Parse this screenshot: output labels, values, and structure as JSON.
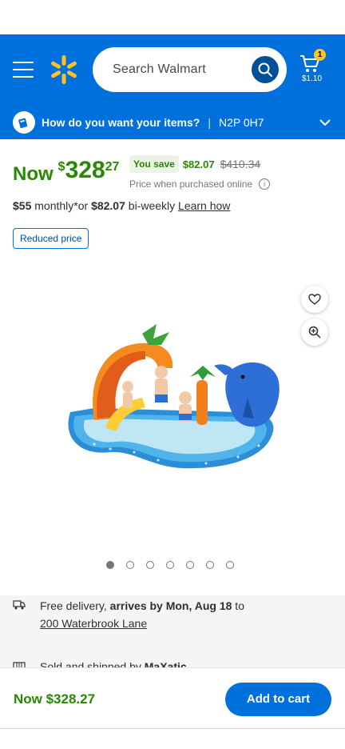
{
  "header": {
    "search_placeholder": "Search Walmart",
    "cart_count": "1",
    "cart_total": "$1.10"
  },
  "delivery_bar": {
    "question": "How do you want your items?",
    "separator": "|",
    "postal_code": "N2P 0H7"
  },
  "price": {
    "now_label": "Now",
    "currency": "$",
    "dollars": "328",
    "cents": "27",
    "you_save_label": "You save",
    "save_amount": "$82.07",
    "was_price": "$410.34",
    "price_note": "Price when purchased online"
  },
  "finance": {
    "monthly": "$55",
    "monthly_text": " monthly*or ",
    "biweekly": "$82.07",
    "biweekly_text": " bi-weekly ",
    "learn_how": "Learn how"
  },
  "badge": {
    "reduced": "Reduced price"
  },
  "carousel": {
    "total": 7,
    "active_index": 0
  },
  "fulfillment": {
    "delivery_prefix": "Free delivery, ",
    "delivery_date": "arrives by Mon, Aug 18",
    "delivery_to": " to",
    "address": "200 Waterbrook Lane",
    "sold_prefix": "Sold and shipped by ",
    "seller": "MaXatic"
  },
  "bottom_bar": {
    "price": "Now $328.27",
    "add_to_cart": "Add to cart"
  },
  "colors": {
    "brand_blue": "#0071dc",
    "dark_blue": "#004f9a",
    "spark_yellow": "#ffc220",
    "price_green": "#2a8703"
  },
  "icons": [
    "menu-icon",
    "walmart-spark-logo",
    "search-icon",
    "cart-icon",
    "delivery-icon",
    "chevron-down-icon",
    "info-icon",
    "heart-icon",
    "zoom-icon",
    "truck-icon",
    "store-icon"
  ]
}
